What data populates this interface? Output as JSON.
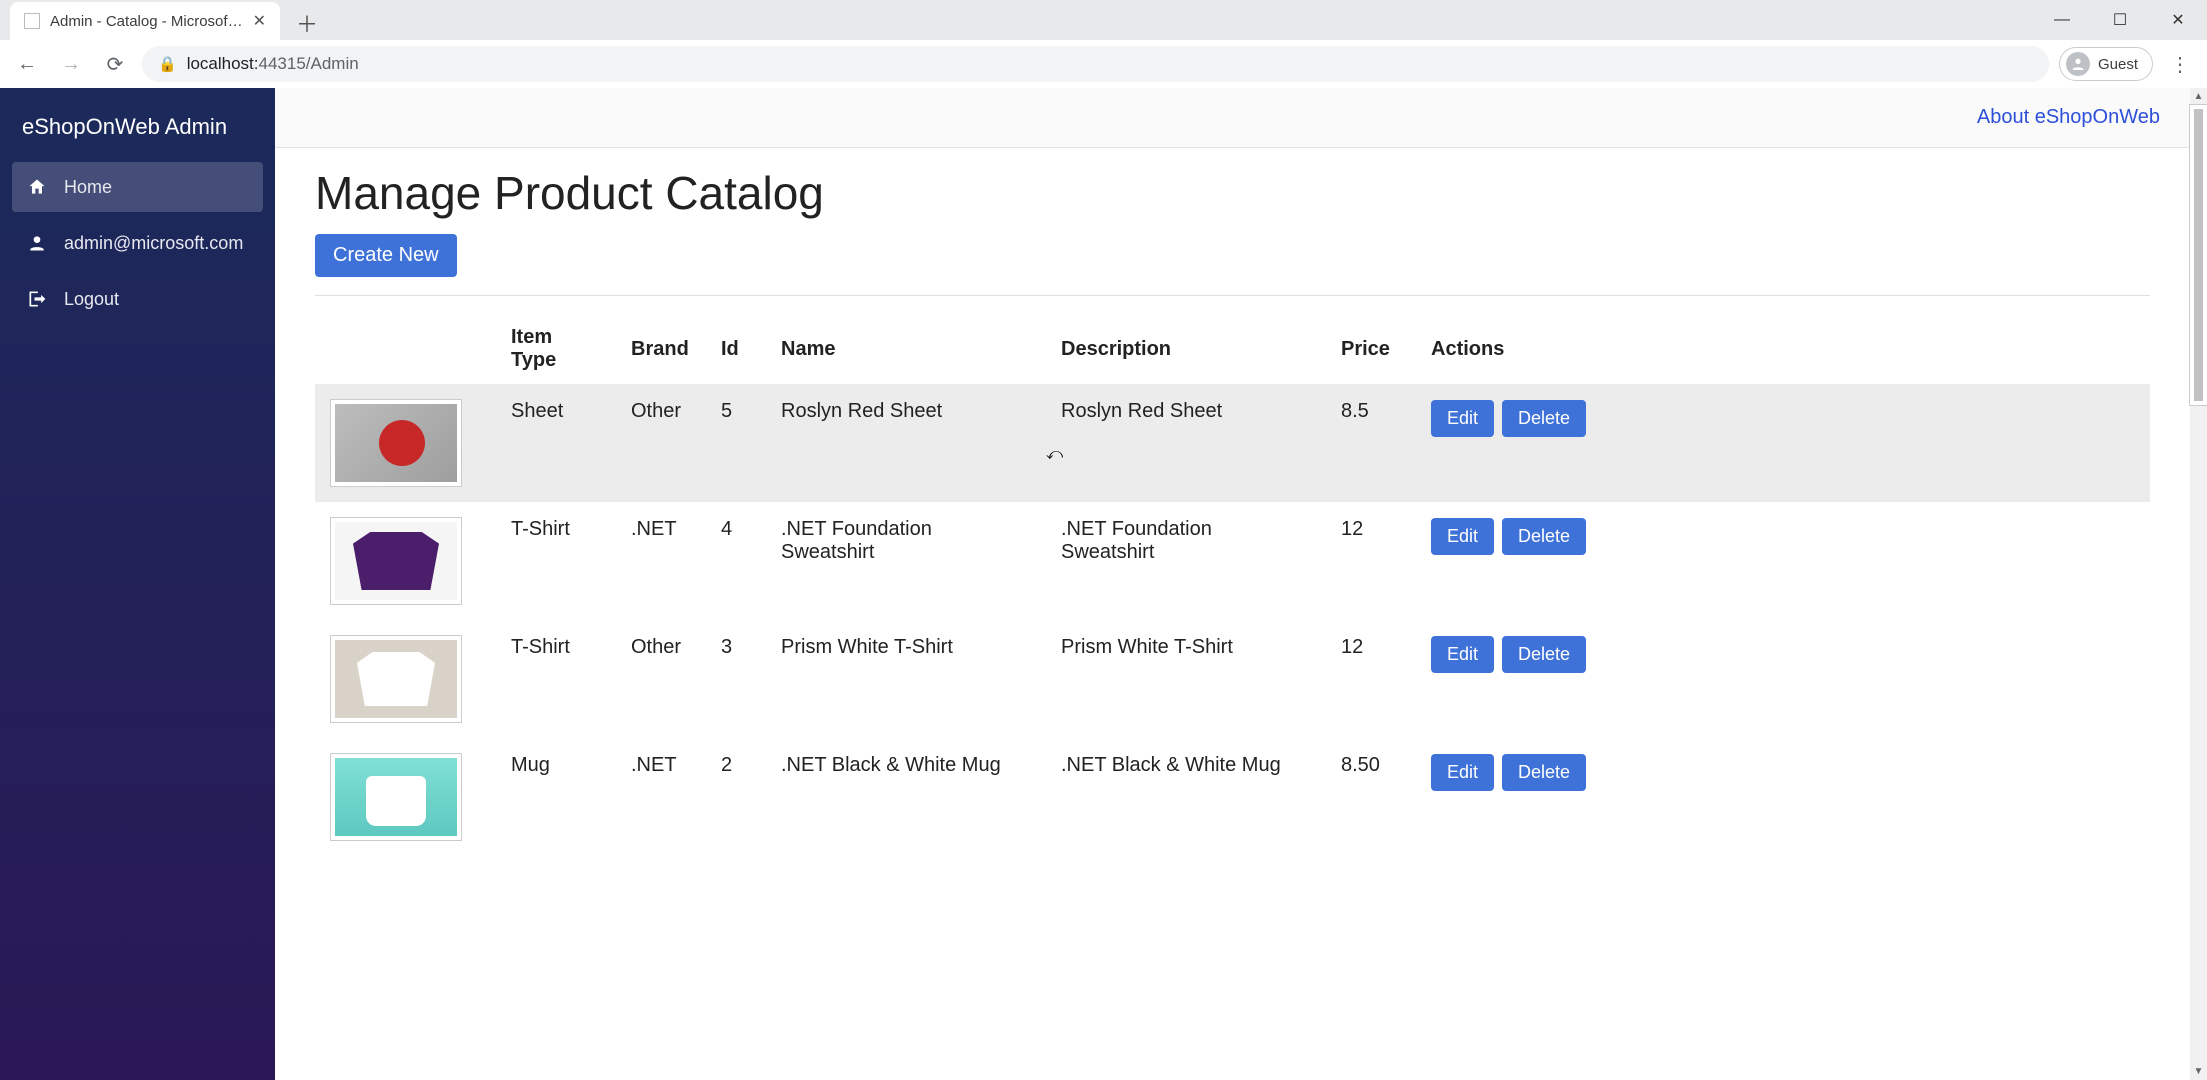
{
  "browser": {
    "tab_title": "Admin - Catalog - Microsoft.eShopOnWeb",
    "url_host": "localhost:",
    "url_port_path": "44315/Admin",
    "guest_label": "Guest"
  },
  "sidebar": {
    "brand": "eShopOnWeb Admin",
    "items": [
      {
        "label": "Home"
      },
      {
        "label": "admin@microsoft.com"
      },
      {
        "label": "Logout"
      }
    ]
  },
  "header": {
    "about_link": "About eShopOnWeb"
  },
  "page": {
    "title": "Manage Product Catalog",
    "create_label": "Create New"
  },
  "table": {
    "headers": {
      "image": "",
      "item_type": "Item Type",
      "brand": "Brand",
      "id": "Id",
      "name": "Name",
      "description": "Description",
      "price": "Price",
      "actions": "Actions"
    },
    "edit_label": "Edit",
    "delete_label": "Delete",
    "rows": [
      {
        "item_type": "Sheet",
        "brand": "Other",
        "id": "5",
        "name": "Roslyn Red Sheet",
        "description": "Roslyn Red Sheet",
        "price": "8.5",
        "thumb": "th-red",
        "hover": true
      },
      {
        "item_type": "T-Shirt",
        "brand": ".NET",
        "id": "4",
        "name": ".NET Foundation Sweatshirt",
        "description": ".NET Foundation Sweatshirt",
        "price": "12",
        "thumb": "th-purple",
        "hover": false
      },
      {
        "item_type": "T-Shirt",
        "brand": "Other",
        "id": "3",
        "name": "Prism White T-Shirt",
        "description": "Prism White T-Shirt",
        "price": "12",
        "thumb": "th-white",
        "hover": false
      },
      {
        "item_type": "Mug",
        "brand": ".NET",
        "id": "2",
        "name": ".NET Black & White Mug",
        "description": ".NET Black & White Mug",
        "price": "8.50",
        "thumb": "th-mug",
        "hover": false
      }
    ]
  }
}
